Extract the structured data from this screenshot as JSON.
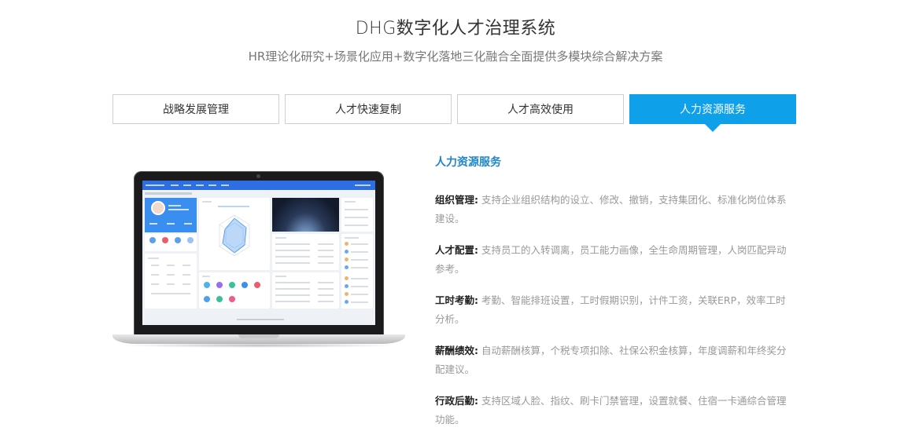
{
  "header": {
    "title": "DHG数字化人才治理系统",
    "subtitle": "HR理论化研究+场景化应用+数字化落地三化融合全面提供多模块综合解决方案"
  },
  "tabs": [
    {
      "label": "战略发展管理",
      "active": false
    },
    {
      "label": "人才快速复制",
      "active": false
    },
    {
      "label": "人才高效使用",
      "active": false
    },
    {
      "label": "人力资源服务",
      "active": true
    }
  ],
  "content": {
    "section_title": "人力资源服务",
    "features": [
      {
        "name": "组织管理:",
        "desc": "支持企业组织结构的设立、修改、撤销，支持集团化、标准化岗位体系建设。"
      },
      {
        "name": "人才配置:",
        "desc": "支持员工的入转调离，员工能力画像，全生命周期管理，人岗匹配异动参考。"
      },
      {
        "name": "工时考勤:",
        "desc": "考勤、智能排班设置，工时假期识别，计件工资，关联ERP，效率工时分析。"
      },
      {
        "name": "薪酬绩效:",
        "desc": "自动薪酬核算，个税专项扣除、社保公积金核算，年度调薪和年终奖分配建议。"
      },
      {
        "name": "行政后勤:",
        "desc": "支持区域人脸、指纹、刷卡门禁管理，设置就餐、住宿一卡通综合管理功能。"
      }
    ]
  },
  "colors": {
    "accent": "#0ea0e8",
    "section_title": "#1e86c8"
  }
}
